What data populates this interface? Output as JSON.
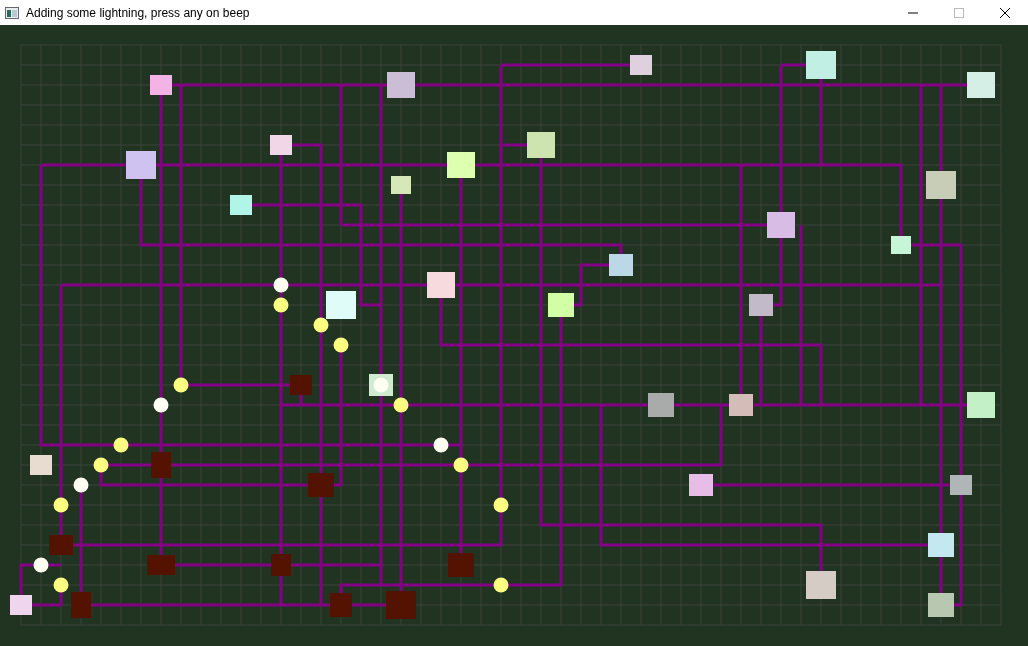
{
  "window": {
    "title": "Adding some lightning, press any on beep"
  }
}
